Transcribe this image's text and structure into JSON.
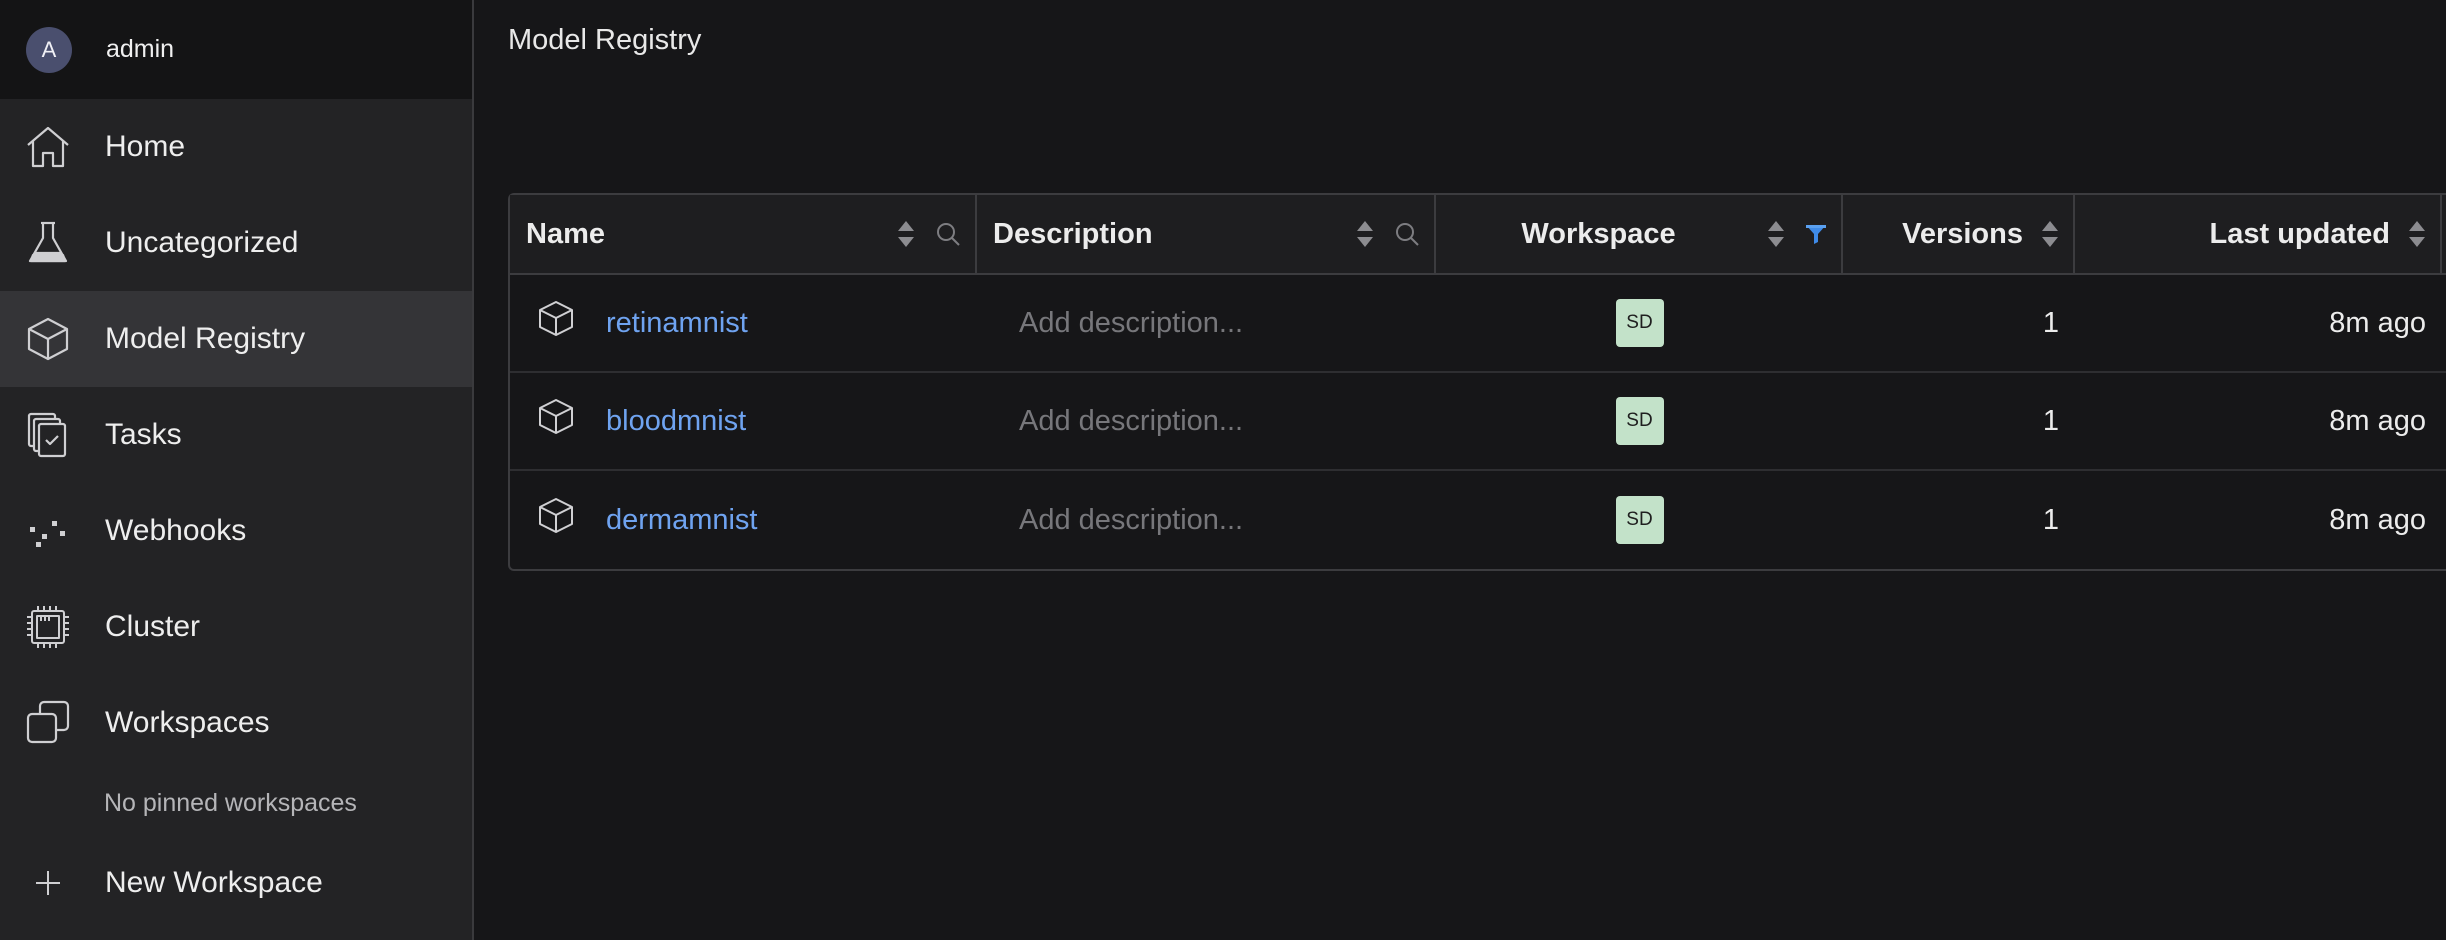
{
  "user": {
    "initial": "A",
    "name": "admin"
  },
  "nav": {
    "home": "Home",
    "uncategorized": "Uncategorized",
    "model_registry": "Model Registry",
    "tasks": "Tasks",
    "webhooks": "Webhooks",
    "cluster": "Cluster",
    "workspaces": "Workspaces",
    "no_pinned": "No pinned workspaces",
    "new_workspace": "New Workspace",
    "active": "model_registry"
  },
  "page": {
    "title": "Model Registry"
  },
  "table": {
    "headers": {
      "name": "Name",
      "description": "Description",
      "workspace": "Workspace",
      "versions": "Versions",
      "last_updated": "Last updated"
    },
    "rows": [
      {
        "name": "retinamnist",
        "description_placeholder": "Add description...",
        "workspace": "SD",
        "versions": "1",
        "last_updated": "8m ago"
      },
      {
        "name": "bloodmnist",
        "description_placeholder": "Add description...",
        "workspace": "SD",
        "versions": "1",
        "last_updated": "8m ago"
      },
      {
        "name": "dermamnist",
        "description_placeholder": "Add description...",
        "workspace": "SD",
        "versions": "1",
        "last_updated": "8m ago"
      }
    ]
  },
  "colors": {
    "link": "#6fa3f0",
    "filter_active": "#3f8be8",
    "workspace_badge": "#c3e2c9",
    "active_nav": "#343437"
  }
}
